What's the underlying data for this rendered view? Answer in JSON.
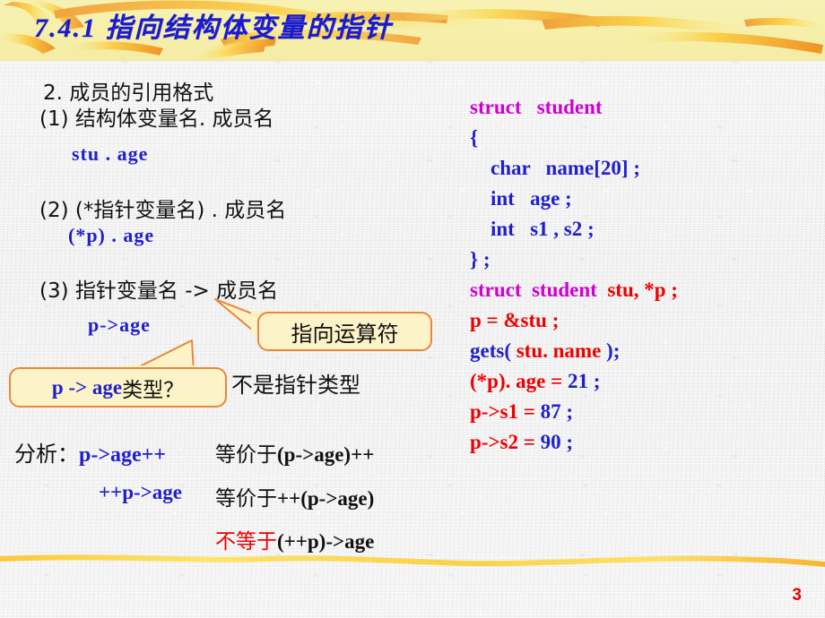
{
  "slide": {
    "title": "7.4.1 指向结构体变量的指针",
    "page_number": "3",
    "title_color": "#1a1ad0",
    "header_color": "#f6efa4",
    "accent_color": "#e8873c",
    "code_blue": "#1f1fcc",
    "code_red": "#ee0000",
    "code_magenta": "#d000d0"
  },
  "left": {
    "heading": "2. 成员的引用格式",
    "item1_label": "(1) 结构体变量名. 成员名",
    "item1_code": "stu . age",
    "item2_label": "(2) (*指针变量名) . 成员名",
    "item2_code": "(*p) . age",
    "item3_label": "(3) 指针变量名 -> 成员名",
    "item3_code": "p->age",
    "note_not_pointer": "不是指针类型"
  },
  "bubbles": [
    {
      "text": "指向运算符"
    },
    {
      "text_code": "p -> age",
      "text_cn": "类型？"
    }
  ],
  "analysis": {
    "label": "分析：",
    "rows": [
      {
        "code": "p->age++",
        "relation": "等价于",
        "relation_color": "#111111",
        "result": "(p->age)++"
      },
      {
        "code": "++p->age",
        "relation": "等价于",
        "relation_color": "#111111",
        "result": "++(p->age)"
      },
      {
        "code": "",
        "relation": "不等于",
        "relation_color": "#ee0000",
        "result": "(++p)->age"
      }
    ]
  },
  "code": {
    "lines": [
      {
        "parts": [
          {
            "t": "struct   student",
            "c": "mag"
          }
        ]
      },
      {
        "parts": [
          {
            "t": "{",
            "c": "blue"
          }
        ]
      },
      {
        "parts": [
          {
            "t": "    char   name[20] ;",
            "c": "blue"
          }
        ]
      },
      {
        "parts": [
          {
            "t": "    int   age ;",
            "c": "blue"
          }
        ]
      },
      {
        "parts": [
          {
            "t": "    int   s1 , s2 ;",
            "c": "blue"
          }
        ]
      },
      {
        "parts": [
          {
            "t": "} ;",
            "c": "blue"
          }
        ]
      },
      {
        "parts": [
          {
            "t": "struct  student  ",
            "c": "mag"
          },
          {
            "t": "stu, *p ;",
            "c": "red"
          }
        ]
      },
      {
        "parts": [
          {
            "t": "p = &stu ;",
            "c": "red"
          }
        ]
      },
      {
        "parts": [
          {
            "t": "gets( ",
            "c": "blue"
          },
          {
            "t": "stu. name",
            "c": "red"
          },
          {
            "t": " );",
            "c": "blue"
          }
        ]
      },
      {
        "parts": [
          {
            "t": "(*p). age = ",
            "c": "red"
          },
          {
            "t": "21 ;",
            "c": "blue"
          }
        ]
      },
      {
        "parts": [
          {
            "t": "p->s1 = ",
            "c": "red"
          },
          {
            "t": "87 ;",
            "c": "blue"
          }
        ]
      },
      {
        "parts": [
          {
            "t": "p->s2 = ",
            "c": "red"
          },
          {
            "t": "90 ;",
            "c": "blue"
          }
        ]
      }
    ]
  }
}
